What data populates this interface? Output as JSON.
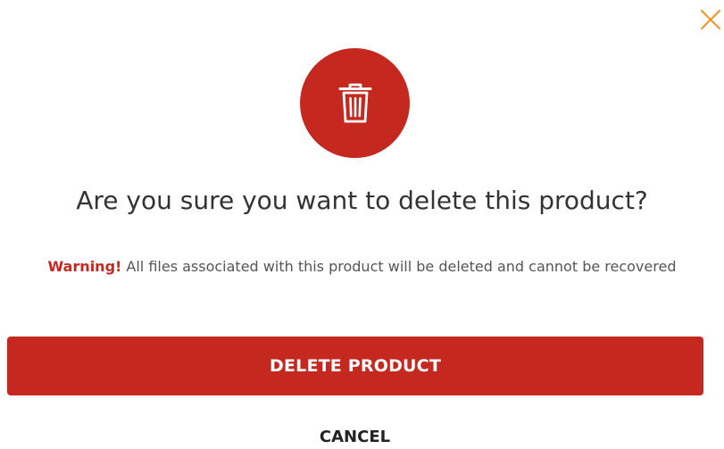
{
  "dialog": {
    "title": "Are you sure you want to delete this product?",
    "warning_label": "Warning!",
    "warning_text": "All files associated with this product will be deleted and cannot be recovered",
    "delete_label": "DELETE PRODUCT",
    "cancel_label": "CANCEL",
    "close_icon": "close-icon",
    "main_icon": "trash-icon"
  },
  "colors": {
    "accent": "#c5281f",
    "close": "#f0962d",
    "title_text": "#333333",
    "body_text": "#555555"
  }
}
